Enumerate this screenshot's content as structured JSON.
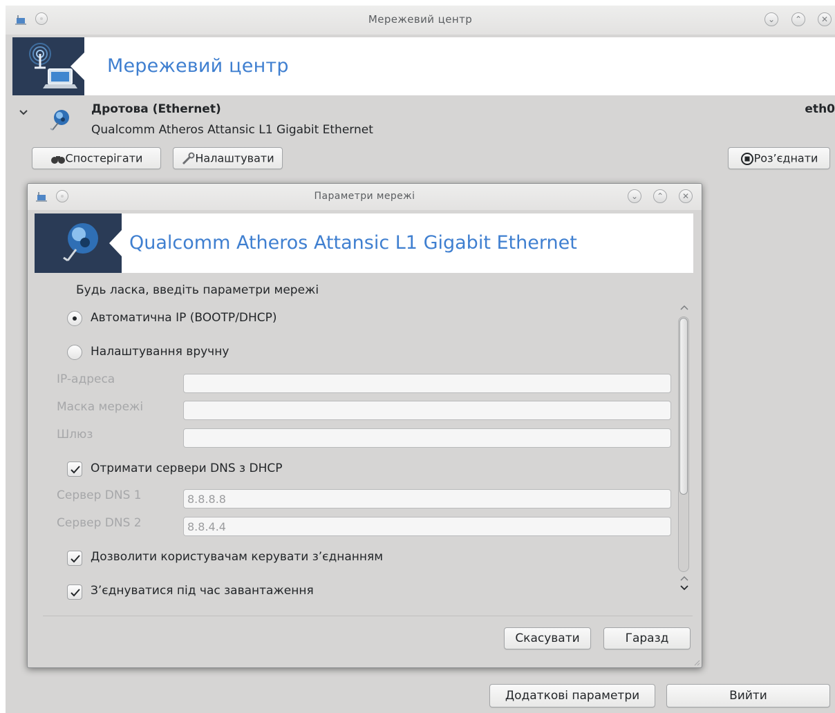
{
  "window": {
    "title": "Мережевий центр",
    "header_title": "Мережевий центр"
  },
  "interface": {
    "name": "Дротова (Ethernet)",
    "description": "Qualcomm Atheros Attansic L1 Gigabit Ethernet",
    "device": "eth0",
    "monitor_label": "Спостерігати",
    "configure_label": "Налаштувати",
    "disconnect_label": "Роз’єднати"
  },
  "dialog": {
    "title": "Параметри мережі",
    "header_title": "Qualcomm Atheros Attansic L1 Gigabit Ethernet",
    "prompt": "Будь ласка, введіть параметри мережі",
    "radio_auto_label": "Автоматична IP (BOOTP/DHCP)",
    "radio_manual_label": "Налаштування вручну",
    "selected_mode": "auto",
    "ip_label": "IP-адреса",
    "ip_value": "",
    "netmask_label": "Маска мережі",
    "netmask_value": "",
    "gateway_label": "Шлюз",
    "gateway_value": "",
    "dns_from_dhcp_label": "Отримати сервери DNS з DHCP",
    "dns_from_dhcp_checked": true,
    "dns1_label": "Сервер DNS 1",
    "dns1_value": "8.8.8.8",
    "dns2_label": "Сервер DNS 2",
    "dns2_value": "8.8.4.4",
    "allow_users_label": "Дозволити користувачам керувати з’єднанням",
    "allow_users_checked": true,
    "connect_boot_label": "З’єднуватися під час завантаження",
    "connect_boot_checked": true,
    "cancel_label": "Скасувати",
    "ok_label": "Гаразд"
  },
  "footer": {
    "advanced_label": "Додаткові параметри",
    "quit_label": "Вийти"
  },
  "icons": [
    "network-app-icon",
    "window-menu-icon",
    "minimize-icon",
    "maximize-icon",
    "close-icon",
    "antenna-laptop-icon",
    "chevron-down-icon",
    "ethernet-globe-icon",
    "binoculars-icon",
    "wrench-icon",
    "stop-circle-icon",
    "chevron-up-icon",
    "resize-grip-icon"
  ],
  "colors": {
    "accent": "#3f7fd0",
    "banner_icon_bg": "#2a3b56",
    "window_bg": "#d6d5d4"
  }
}
